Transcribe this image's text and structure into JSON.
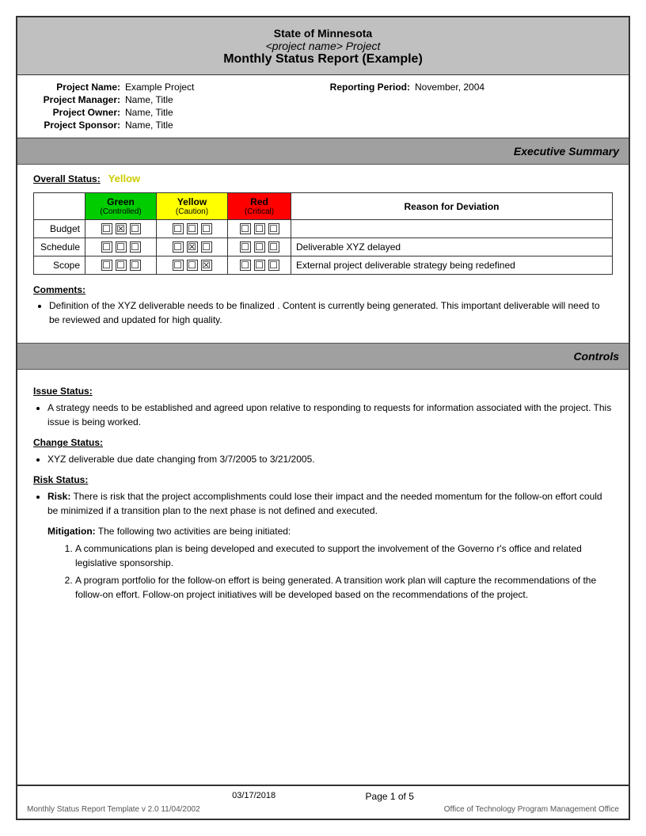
{
  "header": {
    "line1": "State of Minnesota",
    "line2": "<project name> Project",
    "line3": "Monthly Status Report (Example)"
  },
  "projectInfo": {
    "nameLabel": "Project Name:",
    "nameValue": "Example Project",
    "reportingLabel": "Reporting Period:",
    "reportingValue": "November, 2004",
    "managerLabel": "Project Manager:",
    "managerValue": "Name, Title",
    "ownerLabel": "Project Owner:",
    "ownerValue": "Name, Title",
    "sponsorLabel": "Project Sponsor:",
    "sponsorValue": "Name, Title"
  },
  "execSummary": {
    "sectionTitle": "Executive Summary",
    "overallStatusLabel": "Overall Status:",
    "overallStatusValue": "Yellow",
    "table": {
      "headers": {
        "col1": "Green",
        "col1sub": "(Controlled)",
        "col2": "Yellow",
        "col2sub": "(Caution)",
        "col3": "Red",
        "col3sub": "(Critical)",
        "col4": "Reason for Deviation"
      },
      "rows": [
        {
          "label": "Budget",
          "green": [
            false,
            true,
            false
          ],
          "yellow": [
            false,
            false,
            false
          ],
          "red": [
            false,
            false,
            false
          ],
          "reason": ""
        },
        {
          "label": "Schedule",
          "green": [
            false,
            false,
            false
          ],
          "yellow": [
            false,
            true,
            false
          ],
          "red": [
            false,
            false,
            false
          ],
          "reason": "Deliverable XYZ delayed"
        },
        {
          "label": "Scope",
          "green": [
            false,
            false,
            false
          ],
          "yellow": [
            false,
            false,
            true
          ],
          "red": [
            false,
            false,
            false
          ],
          "reason": "External project deliverable strategy being redefined"
        }
      ]
    },
    "commentsTitle": "Comments:",
    "comments": [
      "Definition of the XYZ deliverable  needs to be finalized .  Content is currently being generated.  This important deliverable will need to be reviewed and updated for high quality."
    ]
  },
  "controls": {
    "sectionTitle": "Controls",
    "issueStatusTitle": "Issue Status:",
    "issueItems": [
      "A strategy needs to be established and agreed upon relative to  responding to  requests for information associated with the project.  This issue is being worked."
    ],
    "changeStatusTitle": "Change Status:",
    "changeItems": [
      "XYZ  deliverable due date changing from   3/7/2005 to 3/21/2005."
    ],
    "riskStatusTitle": "Risk Status:",
    "riskLabel": "Risk:",
    "riskText": "There is risk that the project accomplishments could lose their impact and the needed momentum for the follow-on effort could be   minimized if a transition plan to the next phase is not defined and executed.",
    "mitigationLabel": "Mitigation:",
    "mitigationIntro": "The following two activities are being initiated:",
    "mitigationItems": [
      "A communications plan is being developed and executed to support the involvement of the Governo r's office and related legislative sponsorship.",
      "A program portfolio for the follow-on effort is being generated.  A transition work plan will capture the recommendations of the follow-on effort. Follow-on project initiatives will be developed based on the recommendations of the project."
    ]
  },
  "footer": {
    "date": "03/17/2018",
    "pageText": "Page 1 of 5",
    "templateText": "Monthly Status Report Template  v 2.0  11/04/2002",
    "officeText": "Office of Technology Program Management Office"
  }
}
